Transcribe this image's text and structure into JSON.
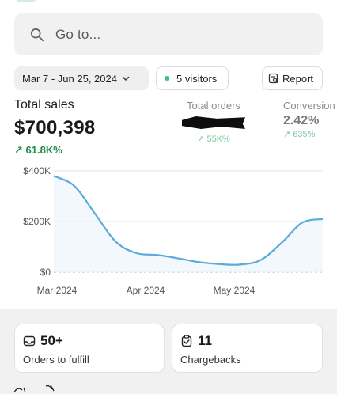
{
  "search": {
    "placeholder": "Go to..."
  },
  "controls": {
    "date_range": "Mar 7 - Jun 25, 2024",
    "visitors": "5 visitors",
    "report": "Report"
  },
  "metrics": {
    "total_sales": {
      "label": "Total sales",
      "value": "$700,398",
      "change": "61.8K%"
    },
    "total_orders": {
      "label": "Total orders",
      "change": "55K%"
    },
    "conversion": {
      "label": "Conversion",
      "value": "2.42%",
      "change": "635%"
    }
  },
  "chart_data": {
    "type": "line",
    "title": "",
    "xlabel": "",
    "ylabel": "",
    "x_ticks": [
      "Mar 2024",
      "Apr 2024",
      "May 2024"
    ],
    "y_ticks": [
      "$400K",
      "$200K",
      "$0"
    ],
    "ylim": [
      0,
      400000
    ],
    "grid": true,
    "series": [
      {
        "values": [
          380000,
          340000,
          230000,
          120000,
          75000,
          68000,
          55000,
          40000,
          32000,
          30000,
          48000,
          115000,
          195000,
          210000
        ]
      }
    ],
    "baseline_dashed": true,
    "colors": {
      "line": "#5aabd8",
      "fill": "#eaf4fa",
      "grid": "#e6e6e6",
      "baseline": "#9cc8e4"
    }
  },
  "cards": [
    {
      "value": "50+",
      "label": "Orders to fulfill",
      "icon": "inbox-icon"
    },
    {
      "value": "11",
      "label": "Chargebacks",
      "icon": "clipboard-check-icon"
    }
  ],
  "colors": {
    "positive": "#1e8a4b",
    "positive_light": "#7cc7a0"
  }
}
